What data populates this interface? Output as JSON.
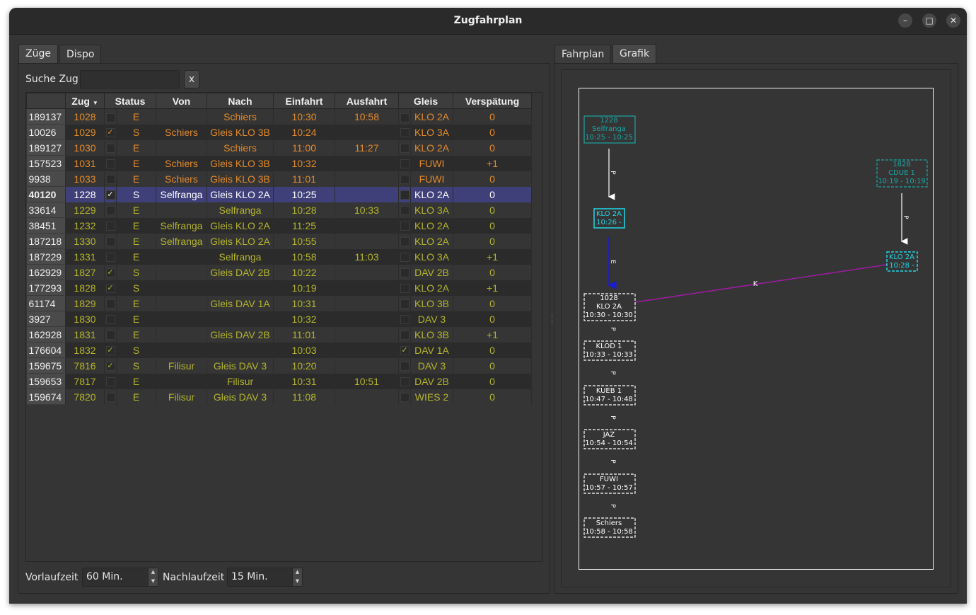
{
  "window": {
    "title": "Zugfahrplan",
    "buttons": [
      "–",
      "□",
      "✕"
    ]
  },
  "left_tabs": [
    "Züge",
    "Dispo"
  ],
  "right_tabs": [
    "Fahrplan",
    "Grafik"
  ],
  "search": {
    "label": "Suche Zug",
    "value": "",
    "clear_label": "x"
  },
  "table": {
    "columns": [
      "Zug",
      "Status",
      "Von",
      "Nach",
      "Einfahrt",
      "Ausfahrt",
      "Gleis",
      "Verspätung"
    ],
    "rows": [
      {
        "id": "189137",
        "zug": "1028",
        "check": false,
        "status": "E",
        "von": "",
        "nach": "Schiers",
        "einfahrt": "10:30",
        "ausfahrt": "10:58",
        "gleis_check": false,
        "gleis": "KLO 2A",
        "versp": "0",
        "color": "#e28a2b"
      },
      {
        "id": "10026",
        "zug": "1029",
        "check": true,
        "status": "S",
        "von": "Schiers",
        "nach": "Gleis KLO 3B",
        "einfahrt": "10:24",
        "ausfahrt": "",
        "gleis_check": false,
        "gleis": "KLO 3A",
        "versp": "0",
        "color": "#e28a2b"
      },
      {
        "id": "189127",
        "zug": "1030",
        "check": false,
        "status": "E",
        "von": "",
        "nach": "Schiers",
        "einfahrt": "11:00",
        "ausfahrt": "11:27",
        "gleis_check": false,
        "gleis": "KLO 2A",
        "versp": "0",
        "color": "#e28a2b"
      },
      {
        "id": "157523",
        "zug": "1031",
        "check": false,
        "status": "E",
        "von": "Schiers",
        "nach": "Gleis KLO 3B",
        "einfahrt": "10:32",
        "ausfahrt": "",
        "gleis_check": false,
        "gleis": "FUWI",
        "versp": "+1",
        "color": "#e28a2b"
      },
      {
        "id": "9938",
        "zug": "1033",
        "check": false,
        "status": "E",
        "von": "Schiers",
        "nach": "Gleis KLO 3B",
        "einfahrt": "11:01",
        "ausfahrt": "",
        "gleis_check": false,
        "gleis": "FUWI",
        "versp": "0",
        "color": "#e28a2b"
      },
      {
        "id": "40120",
        "zug": "1228",
        "check": true,
        "status": "S",
        "von": "Selfranga",
        "nach": "Gleis KLO 2A",
        "einfahrt": "10:25",
        "ausfahrt": "",
        "gleis_check": false,
        "gleis": "KLO 2A",
        "versp": "0",
        "color": "#ffffff",
        "selected": true
      },
      {
        "id": "33614",
        "zug": "1229",
        "check": false,
        "status": "E",
        "von": "",
        "nach": "Selfranga",
        "einfahrt": "10:28",
        "ausfahrt": "10:33",
        "gleis_check": false,
        "gleis": "KLO 3A",
        "versp": "0",
        "color": "#b4b42e"
      },
      {
        "id": "38451",
        "zug": "1232",
        "check": false,
        "status": "E",
        "von": "Selfranga",
        "nach": "Gleis KLO 2A",
        "einfahrt": "11:25",
        "ausfahrt": "",
        "gleis_check": false,
        "gleis": "KLO 2A",
        "versp": "0",
        "color": "#b4b42e"
      },
      {
        "id": "187218",
        "zug": "1330",
        "check": false,
        "status": "E",
        "von": "Selfranga",
        "nach": "Gleis KLO 2A",
        "einfahrt": "10:55",
        "ausfahrt": "",
        "gleis_check": false,
        "gleis": "KLO 2A",
        "versp": "0",
        "color": "#b4b42e"
      },
      {
        "id": "187229",
        "zug": "1331",
        "check": false,
        "status": "E",
        "von": "",
        "nach": "Selfranga",
        "einfahrt": "10:58",
        "ausfahrt": "11:03",
        "gleis_check": false,
        "gleis": "KLO 3A",
        "versp": "+1",
        "color": "#b4b42e"
      },
      {
        "id": "162929",
        "zug": "1827",
        "check": true,
        "status": "S",
        "von": "",
        "nach": "Gleis DAV 2B",
        "einfahrt": "10:22",
        "ausfahrt": "",
        "gleis_check": false,
        "gleis": "DAV 2B",
        "versp": "0",
        "color": "#b4b42e"
      },
      {
        "id": "177293",
        "zug": "1828",
        "check": true,
        "status": "S",
        "von": "",
        "nach": "",
        "einfahrt": "10:19",
        "ausfahrt": "",
        "gleis_check": false,
        "gleis": "KLO 2A",
        "versp": "+1",
        "color": "#b4b42e"
      },
      {
        "id": "61174",
        "zug": "1829",
        "check": false,
        "status": "E",
        "von": "",
        "nach": "Gleis DAV 1A",
        "einfahrt": "10:31",
        "ausfahrt": "",
        "gleis_check": false,
        "gleis": "KLO 3B",
        "versp": "0",
        "color": "#b4b42e"
      },
      {
        "id": "3927",
        "zug": "1830",
        "check": false,
        "status": "E",
        "von": "",
        "nach": "",
        "einfahrt": "10:32",
        "ausfahrt": "",
        "gleis_check": false,
        "gleis": "DAV 3",
        "versp": "0",
        "color": "#b4b42e"
      },
      {
        "id": "162928",
        "zug": "1831",
        "check": false,
        "status": "E",
        "von": "",
        "nach": "Gleis DAV 2B",
        "einfahrt": "11:01",
        "ausfahrt": "",
        "gleis_check": false,
        "gleis": "KLO 3B",
        "versp": "+1",
        "color": "#b4b42e"
      },
      {
        "id": "176604",
        "zug": "1832",
        "check": true,
        "status": "S",
        "von": "",
        "nach": "",
        "einfahrt": "10:03",
        "ausfahrt": "",
        "gleis_check": true,
        "gleis": "DAV 1A",
        "versp": "0",
        "color": "#b4b42e"
      },
      {
        "id": "159675",
        "zug": "7816",
        "check": true,
        "status": "S",
        "von": "Filisur",
        "nach": "Gleis DAV 3",
        "einfahrt": "10:20",
        "ausfahrt": "",
        "gleis_check": false,
        "gleis": "DAV 3",
        "versp": "0",
        "color": "#b4b42e"
      },
      {
        "id": "159653",
        "zug": "7817",
        "check": false,
        "status": "E",
        "von": "",
        "nach": "Filisur",
        "einfahrt": "10:31",
        "ausfahrt": "10:51",
        "gleis_check": false,
        "gleis": "DAV 2B",
        "versp": "0",
        "color": "#b4b42e"
      },
      {
        "id": "159674",
        "zug": "7820",
        "check": false,
        "status": "E",
        "von": "Filisur",
        "nach": "Gleis DAV 3",
        "einfahrt": "11:08",
        "ausfahrt": "",
        "gleis_check": false,
        "gleis": "WIES 2",
        "versp": "0",
        "color": "#b4b42e"
      }
    ]
  },
  "footer": {
    "vorlauf_label": "Vorlaufzeit",
    "vorlauf_value": "60 Min.",
    "nachlauf_label": "Nachlaufzeit",
    "nachlauf_value": "15 Min."
  },
  "graph": {
    "nodes": [
      {
        "lines": [
          "1228",
          "Selfranga",
          "10:25 - 10:25"
        ],
        "style": "solid",
        "color": "#1aa6a6"
      },
      {
        "lines": [
          "KLO 2A",
          "10:26 -"
        ],
        "style": "solid",
        "color": "#22d6e6"
      },
      {
        "lines": [
          "1828",
          "CDUE 1",
          "10:19 - 10:19"
        ],
        "style": "dashed",
        "color": "#1aa6a6"
      },
      {
        "lines": [
          "KLO 2A",
          "10:28 -"
        ],
        "style": "dashed",
        "color": "#22d6e6"
      },
      {
        "lines": [
          "1028",
          "KLO 2A",
          "10:30 - 10:30"
        ],
        "style": "dashed",
        "color": "#ffffff"
      },
      {
        "lines": [
          "KLOD 1",
          "10:33 - 10:33"
        ],
        "style": "dashed",
        "color": "#ffffff"
      },
      {
        "lines": [
          "KUEB 1",
          "10:47 - 10:48"
        ],
        "style": "dashed",
        "color": "#ffffff"
      },
      {
        "lines": [
          "JAZ",
          "10:54 - 10:54"
        ],
        "style": "dashed",
        "color": "#ffffff"
      },
      {
        "lines": [
          "FUWI",
          "10:57 - 10:57"
        ],
        "style": "dashed",
        "color": "#ffffff"
      },
      {
        "lines": [
          "Schiers",
          "10:58 - 10:58"
        ],
        "style": "dashed",
        "color": "#ffffff"
      }
    ],
    "edge_labels": {
      "p": "P",
      "e": "E",
      "k": "K"
    },
    "colors": {
      "white": "#ffffff",
      "blue": "#1a1adc",
      "purple": "#a01aa6"
    }
  }
}
